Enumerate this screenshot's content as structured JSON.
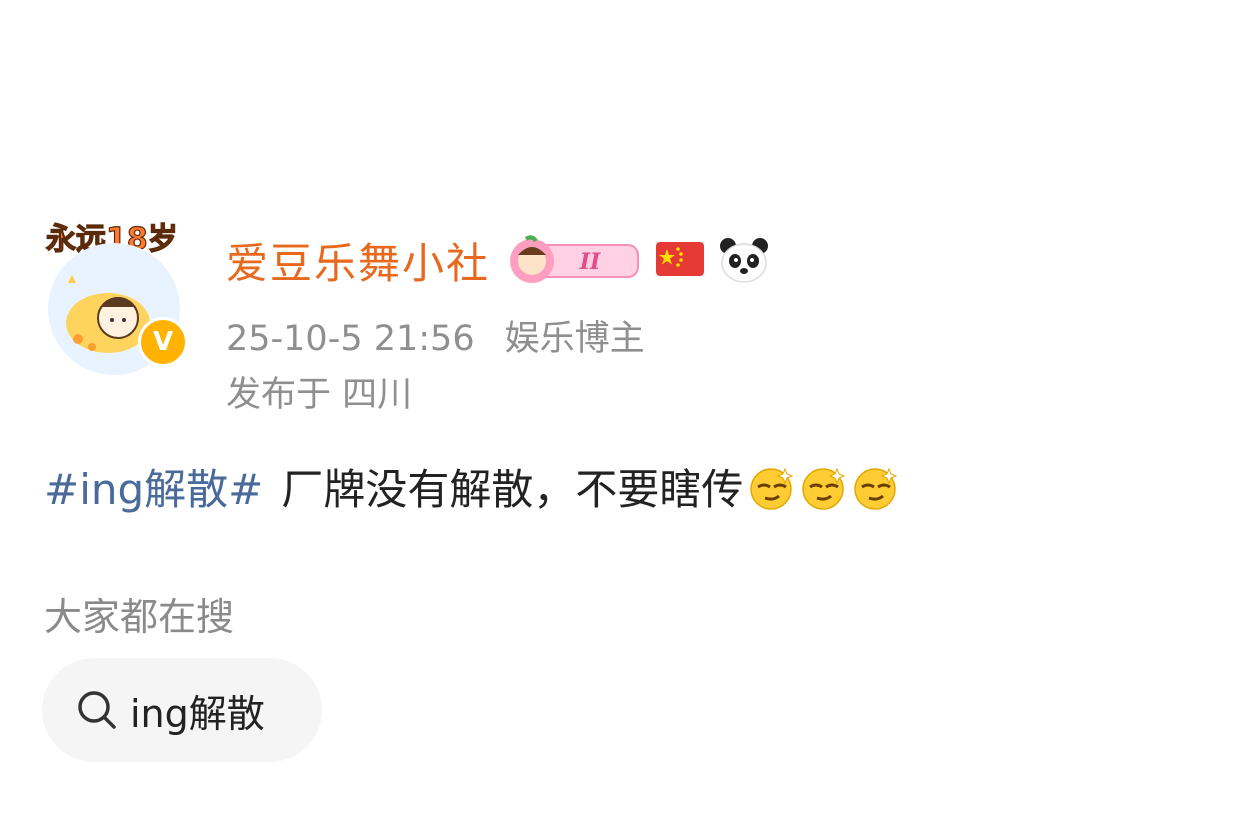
{
  "post": {
    "author": {
      "name": "爱豆乐舞小社",
      "avatar_text": "永远18岁",
      "verified_mark": "V",
      "badge_level": "II"
    },
    "timestamp": "25-10-5 21:56",
    "author_tag": "娱乐博主",
    "location": "发布于 四川",
    "hashtag": "#ing解散#",
    "body": "厂牌没有解散，不要瞎传",
    "emoji": [
      "smirk-emoji",
      "smirk-emoji",
      "smirk-emoji"
    ]
  },
  "search_section": {
    "title": "大家都在搜",
    "chips": [
      {
        "label": "ing解散",
        "icon": "search-icon"
      }
    ]
  },
  "colors": {
    "username": "#e8681e",
    "hashtag": "#4a6a9a",
    "meta": "#8f8f8f",
    "chip_bg": "#f5f5f5"
  }
}
